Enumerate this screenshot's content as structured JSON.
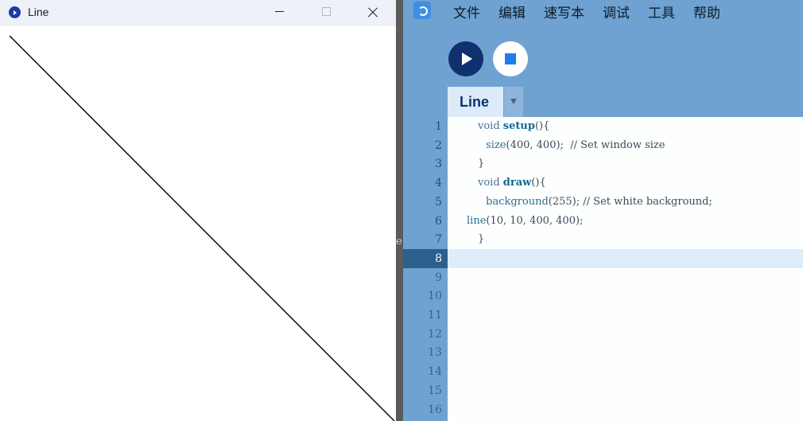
{
  "sketch_window": {
    "title": "Line",
    "canvas": {
      "background": "#ffffff",
      "line_color": "#000000"
    }
  },
  "gap_text": "e",
  "ide": {
    "menu": [
      "文件",
      "编辑",
      "速写本",
      "调试",
      "工具",
      "帮助"
    ],
    "tab": {
      "label": "Line"
    },
    "current_line": 8,
    "line_numbers": [
      "1",
      "2",
      "3",
      "4",
      "5",
      "6",
      "7",
      "8",
      "9",
      "10",
      "11",
      "12",
      "13",
      "14",
      "15",
      "16"
    ],
    "code_lines": [
      [
        {
          "t": "void ",
          "c": "kw"
        },
        {
          "t": "setup",
          "c": "fn"
        },
        {
          "t": "(){",
          "c": ""
        }
      ],
      [
        {
          "t": " size",
          "c": "call"
        },
        {
          "t": "(400, 400);  // Set window size",
          "c": ""
        }
      ],
      [
        {
          "t": "}",
          "c": ""
        }
      ],
      [
        {
          "t": "void ",
          "c": "kw"
        },
        {
          "t": "draw",
          "c": "fn"
        },
        {
          "t": "(){",
          "c": ""
        }
      ],
      [
        {
          "t": " background",
          "c": "call"
        },
        {
          "t": "(255); // Set white background;",
          "c": ""
        }
      ],
      [
        {
          "t": "line",
          "c": "call"
        },
        {
          "t": "(10, 10, 400, 400);",
          "c": ""
        }
      ],
      [
        {
          "t": "}",
          "c": ""
        }
      ]
    ],
    "colors": {
      "background": "#6fa2d0",
      "run_button": "#0f3170",
      "stop_icon": "#1c7fe6",
      "tab": "#dcebf8",
      "current_line_highlight": "#ddeefa"
    }
  }
}
